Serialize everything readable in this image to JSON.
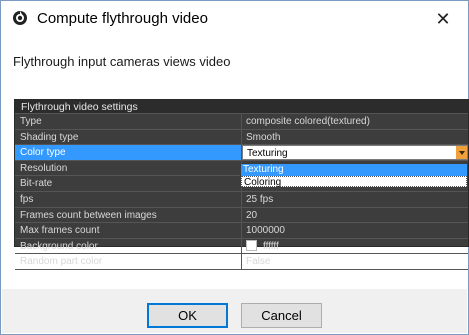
{
  "window": {
    "title": "Compute flythrough video",
    "close_glyph": "✕"
  },
  "subtitle": "Flythrough input cameras views video",
  "grid": {
    "header": "Flythrough video settings",
    "rows": [
      {
        "name": "Type",
        "value": "composite colored(textured)"
      },
      {
        "name": "Shading type",
        "value": "Smooth"
      },
      {
        "name": "Color type",
        "value": "Texturing"
      },
      {
        "name": "Resolution",
        "value": ""
      },
      {
        "name": "Bit-rate",
        "value": ""
      },
      {
        "name": "fps",
        "value": "25 fps"
      },
      {
        "name": "Frames count between images",
        "value": "20"
      },
      {
        "name": "Max frames count",
        "value": "1000000"
      },
      {
        "name": "Background color",
        "value": "ffffff"
      },
      {
        "name": "Random part color",
        "value": "False"
      }
    ]
  },
  "dropdown": {
    "options": [
      "Texturing",
      "Coloring"
    ]
  },
  "buttons": {
    "ok": "OK",
    "cancel": "Cancel"
  },
  "colors": {
    "selection": "#3399ff",
    "grid_bg": "#3d3d3d",
    "dropdown_arrow": "#f0a13c",
    "default_button_border": "#0078d7"
  }
}
